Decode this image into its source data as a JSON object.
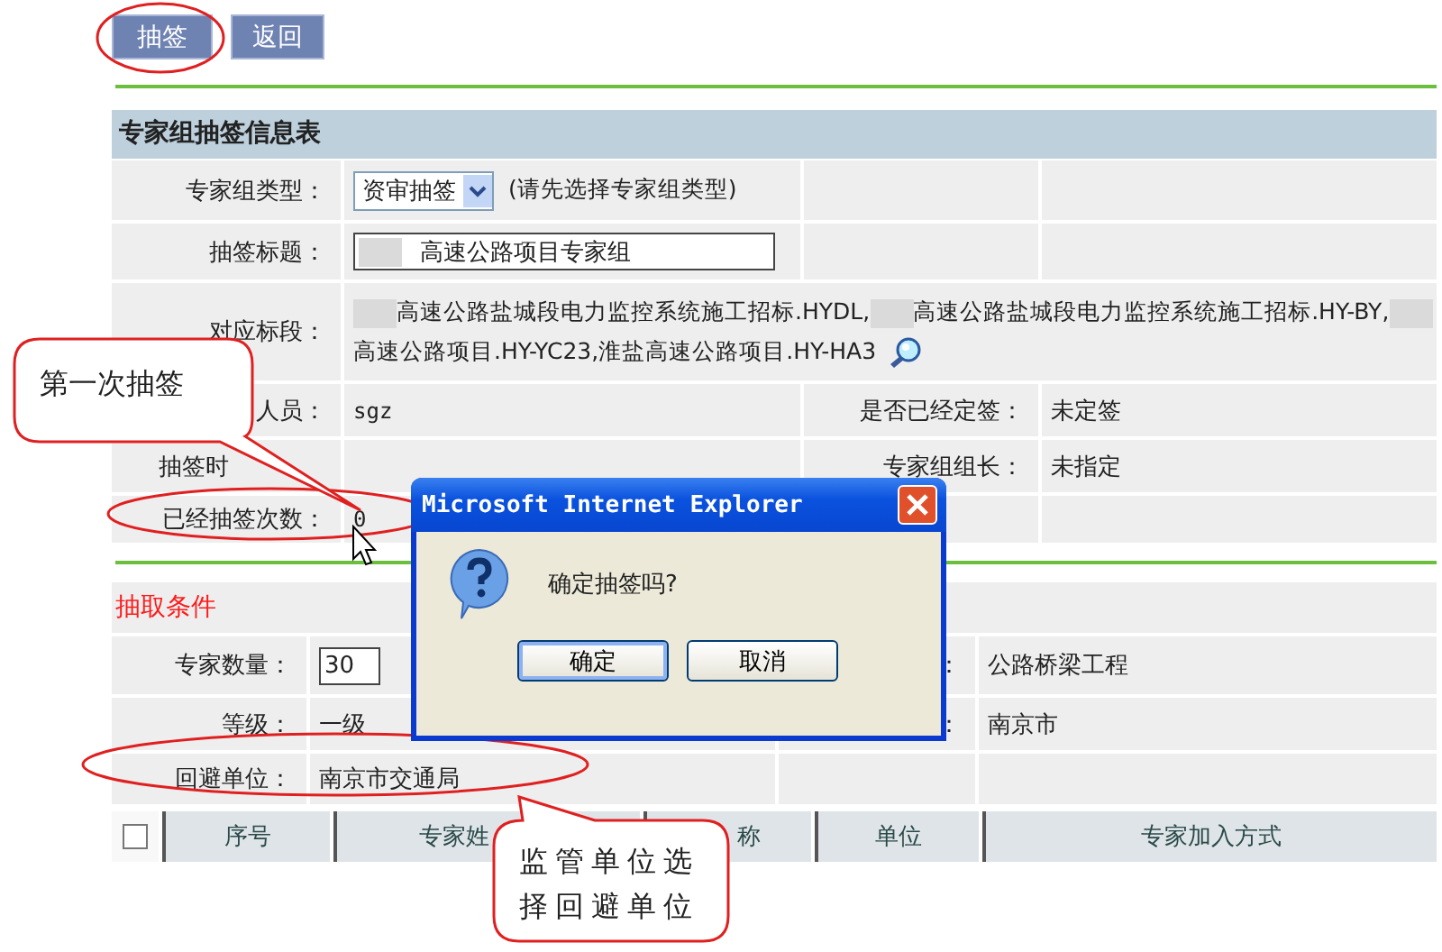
{
  "toolbar": {
    "buttons": [
      {
        "label": "抽签"
      },
      {
        "label": "返回"
      }
    ]
  },
  "info_table": {
    "title": "专家组抽签信息表",
    "rows": [
      {
        "kind": "select",
        "label": "专家组类型：",
        "value": "资审抽签",
        "hint": "(请先选择专家组类型)"
      },
      {
        "kind": "field",
        "label": "抽签标题：",
        "segments": [
          {
            "kind": "redacted"
          },
          {
            "kind": "text",
            "text": "高速公路项目专家组"
          }
        ]
      },
      {
        "kind": "segments",
        "label": "对应标段：",
        "segments": [
          {
            "kind": "redacted"
          },
          {
            "kind": "text",
            "text": "高速公路盐城段电力监控系统施工招标.HYDL,"
          },
          {
            "kind": "redacted"
          },
          {
            "kind": "text",
            "text": "高速公路盐城段电力监控系统施工招标.HY-BY,"
          },
          {
            "kind": "redacted"
          },
          {
            "kind": "text",
            "text": "高速公路项目.HY-YC23,淮盐高速公路项目.HY-HA3"
          }
        ]
      },
      {
        "kind": "pair",
        "label": "人员：",
        "value": "sgz",
        "label2": "是否已经定签：",
        "value2": "未定签"
      },
      {
        "kind": "pair",
        "label": "抽签时",
        "label2": "专家组组长：",
        "value2": "未指定"
      },
      {
        "kind": "pair",
        "label": "已经抽签次数：",
        "value": "0"
      }
    ]
  },
  "conditions": {
    "title": "抽取条件",
    "rows": [
      {
        "kind": "input",
        "label": "专家数量：",
        "value": "30",
        "label2": "：",
        "value2": "公路桥梁工程"
      },
      {
        "kind": "text",
        "label": "等级：",
        "value": "一级",
        "label2": "：",
        "value2": "南京市"
      },
      {
        "kind": "text",
        "label": "回避单位：",
        "value": "南京市交通局"
      }
    ]
  },
  "grid": {
    "checkbox": {
      "checked": false
    },
    "columns": [
      "序号",
      "专家姓",
      "称",
      "单位",
      "专家加入方式"
    ]
  },
  "dialog": {
    "title": "Microsoft Internet Explorer",
    "message": "确定抽签吗?",
    "buttons": [
      {
        "label": "确定",
        "focused": true
      },
      {
        "label": "取消",
        "focused": false
      }
    ]
  },
  "callouts": [
    {
      "text": "第一次抽签"
    },
    {
      "text": "监管单位选择回避单位"
    }
  ]
}
